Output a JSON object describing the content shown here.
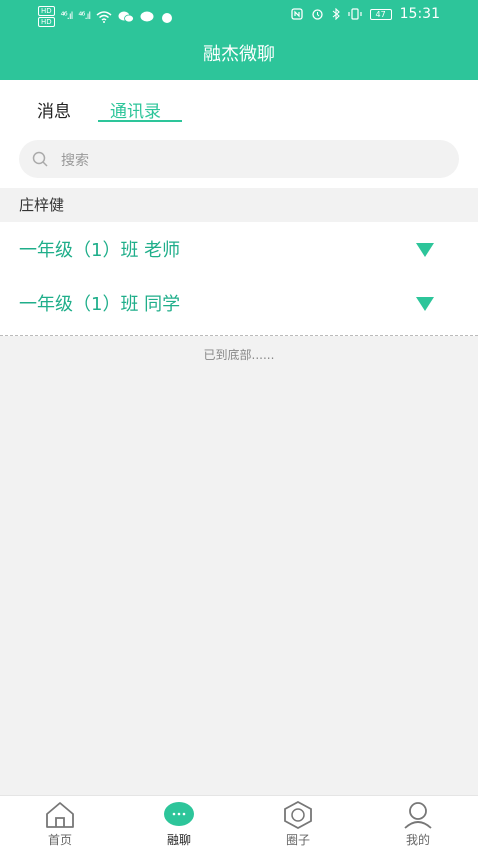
{
  "status_bar": {
    "left_hd_1": "HD",
    "left_hd_2": "HD",
    "signal_1": "⁴⁶.ıl",
    "signal_2": "⁴⁶.ıl",
    "battery": "47",
    "time": "15:31"
  },
  "header": {
    "title": "融杰微聊"
  },
  "tabs": [
    {
      "label": "消息"
    },
    {
      "label": "通讯录"
    }
  ],
  "search": {
    "placeholder": "搜索"
  },
  "contacts": {
    "section_name": "庄梓健",
    "groups": [
      {
        "label": "一年级（1）班 老师"
      },
      {
        "label": "一年级（1）班 同学"
      }
    ],
    "end_text": "已到底部......"
  },
  "bottom_nav": [
    {
      "label": "首页",
      "icon": "home-icon"
    },
    {
      "label": "融聊",
      "icon": "chat-icon"
    },
    {
      "label": "圈子",
      "icon": "circle-icon"
    },
    {
      "label": "我的",
      "icon": "profile-icon"
    }
  ],
  "colors": {
    "accent": "#2dc59a",
    "group_text": "#1fae8a"
  }
}
